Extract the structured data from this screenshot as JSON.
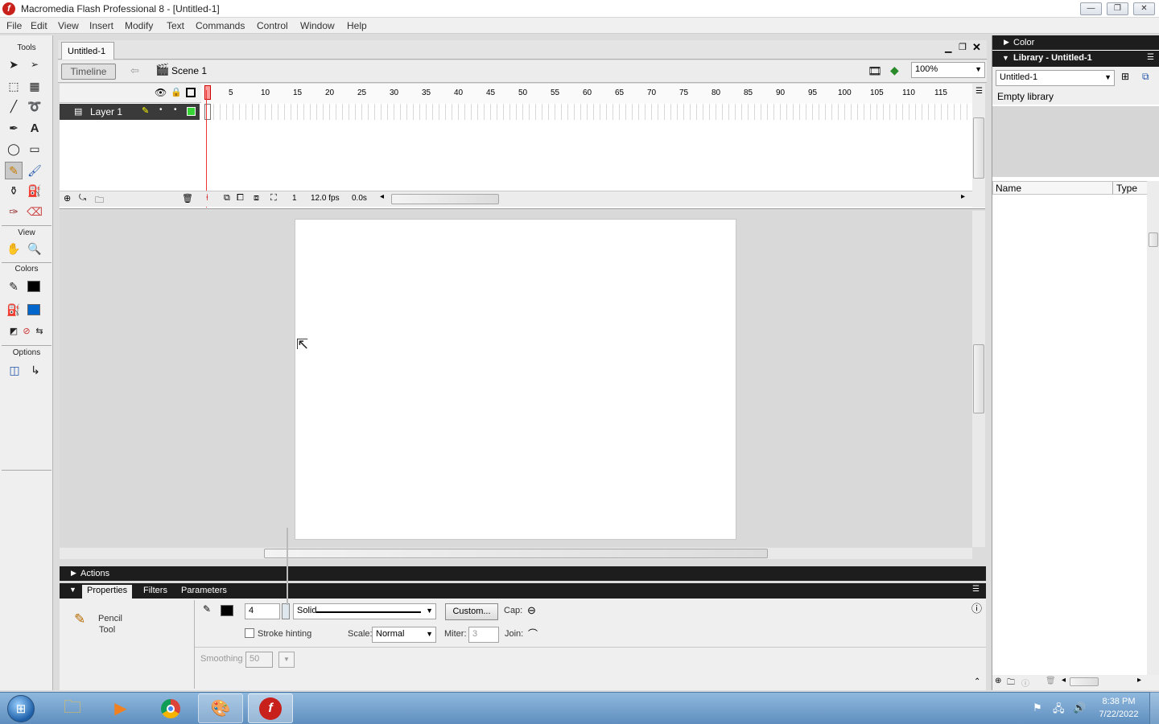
{
  "window": {
    "title": "Macromedia Flash Professional 8 - [Untitled-1]",
    "controls": {
      "minimize": "—",
      "restore": "❐",
      "close": "✕"
    }
  },
  "menu": [
    "File",
    "Edit",
    "View",
    "Insert",
    "Modify",
    "Text",
    "Commands",
    "Control",
    "Window",
    "Help"
  ],
  "toolbox": {
    "tools_label": "Tools",
    "view_label": "View",
    "colors_label": "Colors",
    "options_label": "Options"
  },
  "document": {
    "tab": "Untitled-1",
    "timeline_button": "Timeline",
    "scene": "Scene 1",
    "zoom": "100%"
  },
  "timeline": {
    "ruler": [
      "5",
      "10",
      "15",
      "20",
      "25",
      "30",
      "35",
      "40",
      "45",
      "50",
      "55",
      "60",
      "65",
      "70",
      "75",
      "80",
      "85",
      "90",
      "95",
      "100",
      "105",
      "110",
      "115"
    ],
    "layer_name": "Layer 1",
    "current_frame": "1",
    "fps": "12.0 fps",
    "time": "0.0s"
  },
  "panels": {
    "actions": "Actions",
    "tabs": [
      "Properties",
      "Filters",
      "Parameters"
    ]
  },
  "properties": {
    "tool_name_line1": "Pencil",
    "tool_name_line2": "Tool",
    "stroke_width": "4",
    "stroke_style": "Solid",
    "custom_button": "Custom...",
    "cap_label": "Cap:",
    "stroke_hinting_label": "Stroke hinting",
    "scale_label": "Scale:",
    "scale_value": "Normal",
    "miter_label": "Miter:",
    "miter_value": "3",
    "join_label": "Join:",
    "smoothing_label": "Smoothing",
    "smoothing_value": "50"
  },
  "library": {
    "color_panel": "Color",
    "library_panel": "Library - Untitled-1",
    "document_select": "Untitled-1",
    "status": "Empty library",
    "col_name": "Name",
    "col_type": "Type"
  },
  "taskbar": {
    "time": "8:38 PM",
    "date": "7/22/2022"
  },
  "colors": {
    "flash_red": "#c8211b",
    "dark_bar": "#1d1d1d",
    "stroke_color": "#000000",
    "fill_color": "#0066cc"
  }
}
